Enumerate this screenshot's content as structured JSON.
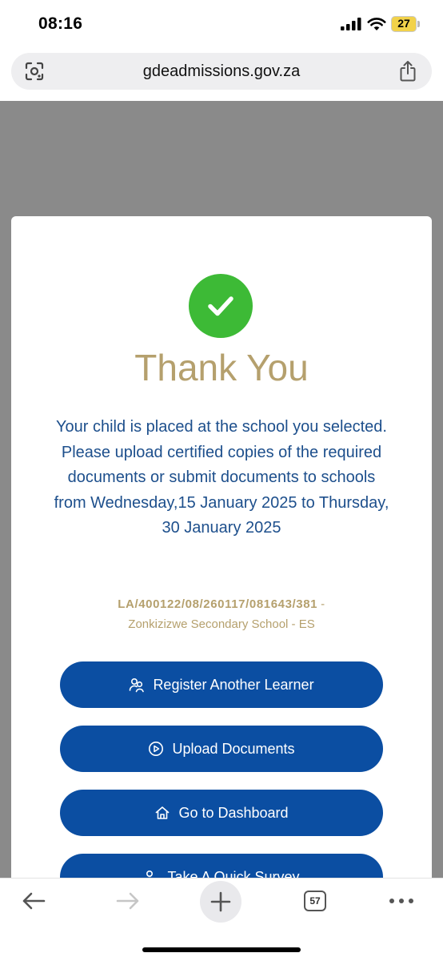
{
  "status_bar": {
    "time": "08:16",
    "battery_level": "27",
    "battery_color": "#f2d24a"
  },
  "browser": {
    "url": "gdeadmissions.gov.za",
    "open_tabs": "57"
  },
  "confirmation": {
    "title": "Thank You",
    "message": "Your child is placed at the school you selected. Please upload certified copies of the required documents or submit documents to schools from Wednesday,15 January 2025 to Thursday, 30 January 2025",
    "reference_number": "LA/400122/08/260117/081643/381",
    "reference_separator": "-",
    "school": "Zonkizizwe Secondary School - ES",
    "success_color": "#3dba36",
    "accent_color": "#b5a06d",
    "text_color": "#1d4f8c"
  },
  "actions": {
    "register_label": "Register Another Learner",
    "upload_label": "Upload Documents",
    "dashboard_label": "Go to Dashboard",
    "survey_label": "Take A Quick Survey",
    "button_color": "#0b4ea2"
  },
  "icons": {
    "status": [
      "signal-icon",
      "wifi-icon",
      "battery-icon"
    ],
    "url_bar": [
      "lens-icon",
      "share-icon"
    ],
    "buttons": [
      "users-icon",
      "play-circle-icon",
      "home-icon",
      "survey-icon"
    ],
    "toolbar": [
      "back-arrow-icon",
      "forward-arrow-icon",
      "plus-icon",
      "tabs-icon",
      "more-icon"
    ]
  }
}
